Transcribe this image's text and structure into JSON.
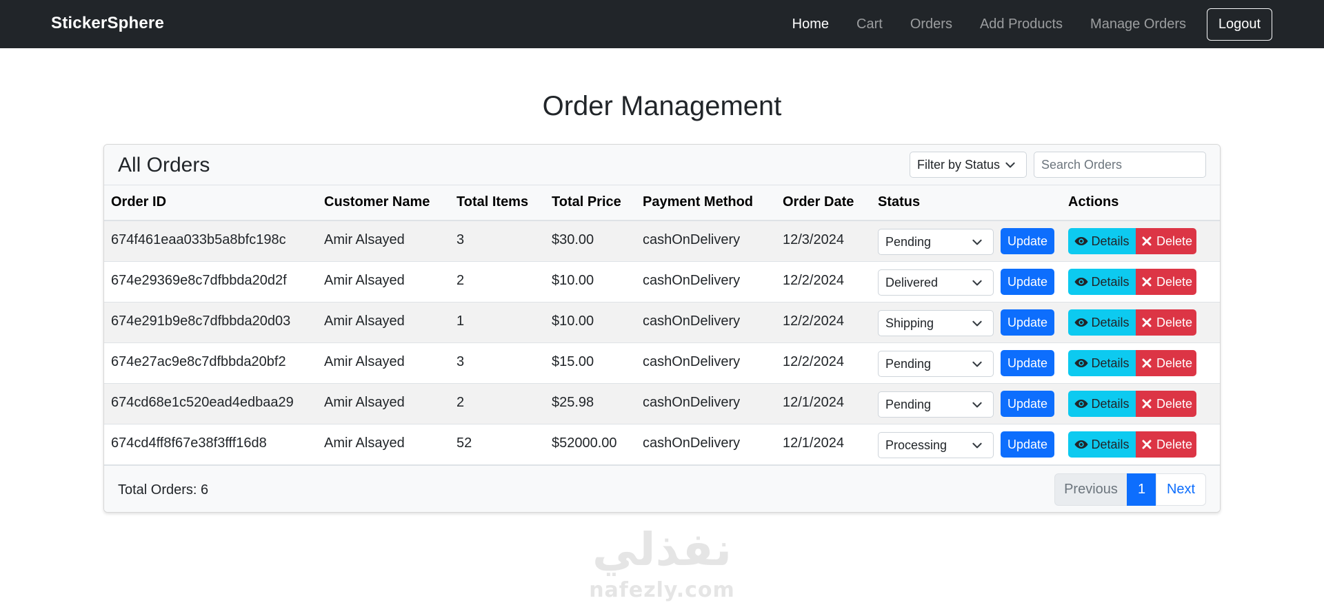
{
  "navbar": {
    "brand": "StickerSphere",
    "links": [
      {
        "label": "Home",
        "active": true
      },
      {
        "label": "Cart",
        "active": false
      },
      {
        "label": "Orders",
        "active": false
      },
      {
        "label": "Add Products",
        "active": false
      },
      {
        "label": "Manage Orders",
        "active": false
      }
    ],
    "logout_label": "Logout"
  },
  "page": {
    "title": "Order Management"
  },
  "card": {
    "title": "All Orders",
    "filter": {
      "selected": "Filter by Status",
      "icon": "chevron-down-icon"
    },
    "search": {
      "placeholder": "Search Orders",
      "value": ""
    }
  },
  "table": {
    "headers": [
      "Order ID",
      "Customer Name",
      "Total Items",
      "Total Price",
      "Payment Method",
      "Order Date",
      "Status",
      "Actions"
    ],
    "rows": [
      {
        "order_id": "674f461eaa033b5a8bfc198c",
        "customer": "Amir Alsayed",
        "items": "3",
        "price": "$30.00",
        "payment": "cashOnDelivery",
        "date": "12/3/2024",
        "status": "Pending"
      },
      {
        "order_id": "674e29369e8c7dfbbda20d2f",
        "customer": "Amir Alsayed",
        "items": "2",
        "price": "$10.00",
        "payment": "cashOnDelivery",
        "date": "12/2/2024",
        "status": "Delivered"
      },
      {
        "order_id": "674e291b9e8c7dfbbda20d03",
        "customer": "Amir Alsayed",
        "items": "1",
        "price": "$10.00",
        "payment": "cashOnDelivery",
        "date": "12/2/2024",
        "status": "Shipping"
      },
      {
        "order_id": "674e27ac9e8c7dfbbda20bf2",
        "customer": "Amir Alsayed",
        "items": "3",
        "price": "$15.00",
        "payment": "cashOnDelivery",
        "date": "12/2/2024",
        "status": "Pending"
      },
      {
        "order_id": "674cd68e1c520ead4edbaa29",
        "customer": "Amir Alsayed",
        "items": "2",
        "price": "$25.98",
        "payment": "cashOnDelivery",
        "date": "12/1/2024",
        "status": "Pending"
      },
      {
        "order_id": "674cd4ff8f67e38f3fff16d8",
        "customer": "Amir Alsayed",
        "items": "52",
        "price": "$52000.00",
        "payment": "cashOnDelivery",
        "date": "12/1/2024",
        "status": "Processing"
      }
    ],
    "update_label": "Update",
    "details_label": "Details",
    "delete_label": "Delete",
    "details_icon": "eye-icon",
    "delete_icon": "x-icon"
  },
  "footer": {
    "total_orders_text": "Total Orders: 6",
    "pagination": {
      "previous": "Previous",
      "current_page": "1",
      "next": "Next"
    }
  },
  "watermark": {
    "arabic": "نفذلي",
    "latin": "nafezly.com"
  },
  "colors": {
    "navbar_bg": "#212529",
    "primary": "#0d6efd",
    "info": "#0dcaf0",
    "danger": "#dc3545",
    "row_stripe": "#f2f2f2"
  }
}
